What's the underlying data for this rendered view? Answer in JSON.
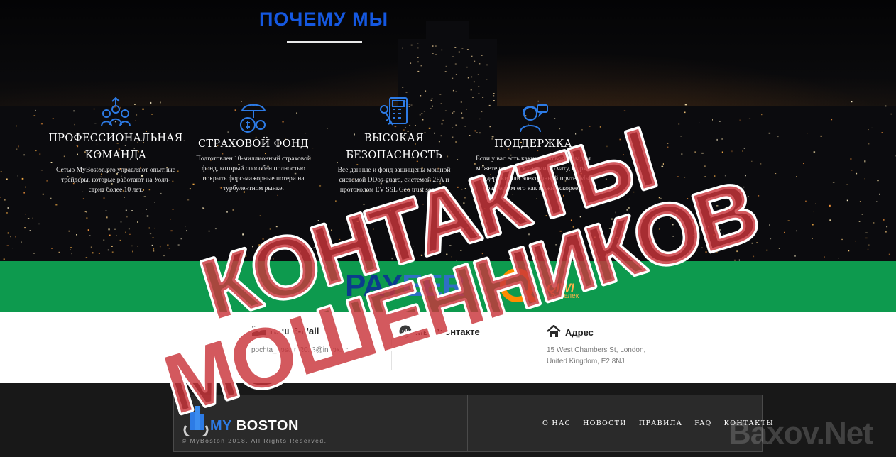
{
  "hero": {
    "title": "ПОЧЕМУ МЫ",
    "features": [
      {
        "title_line1": "ПРОФЕССИОНАЛЬНАЯ",
        "title_line2": "КОМАНДА",
        "icon": "team-icon",
        "description": "Сетью MyBoston.pro управляют опытные трейдеры, которые работают на Уолл-стрит более 10 лет."
      },
      {
        "title_line1": "СТРАХОВОЙ ФОНД",
        "title_line2": "",
        "icon": "insurance-fund-icon",
        "description": "Подготовлен 10-миллионный страховой фонд, который способен полностью покрыть форс-мажорные потери на турбулентном рынке."
      },
      {
        "title_line1": "ВЫСОКАЯ",
        "title_line2": "БЕЗОПАСНОСТЬ",
        "icon": "security-icon",
        "description": "Все данные и фонд защищены мощной системой DDos-guard, системой 2FA и протоколом EV SSL Geo trust security."
      },
      {
        "title_line1": "ПОДДЕРЖКА",
        "title_line2": "",
        "icon": "support-icon",
        "description": "Если у вас есть какие-либо вопросы, вы можете связаться с нами по чату, форме поддержки или электронной почте. Мы разрешим его как можно скорее."
      }
    ]
  },
  "payments": {
    "payeer_part1": "PAY",
    "payeer_part2": "EER",
    "qiwi_label": "QIWI",
    "qiwi_sub": "кошелек"
  },
  "contacts": {
    "email": {
      "title": "Наш E-Mail",
      "value": "pochta_boston.2018@inbox.ru",
      "icon": "envelope-icon"
    },
    "vk": {
      "title": "Мы Вконтакте",
      "value": "",
      "icon": "vk-icon"
    },
    "address": {
      "title": "Адрес",
      "line1": "15 West Chambers St, London,",
      "line2": "United Kingdom, E2 8NJ",
      "icon": "home-icon"
    }
  },
  "footer": {
    "brand_part1": "MY",
    "brand_part2": "BOSTON",
    "copyright": "© MyBoston 2018. All Rights Reserved.",
    "nav": [
      "О НАС",
      "НОВОСТИ",
      "ПРАВИЛА",
      "FAQ",
      "КОНТАКТЫ"
    ]
  },
  "overlay": {
    "stamp_line1": "КОНТАКТЫ",
    "stamp_line2": "МОШЕННИКОВ",
    "watermark": "Baxov.Net"
  },
  "colors": {
    "accent_blue": "#1558e0",
    "pay_band_green": "#0d9a4e",
    "stamp_red": "#c9353b",
    "footer_bg": "#181818"
  }
}
